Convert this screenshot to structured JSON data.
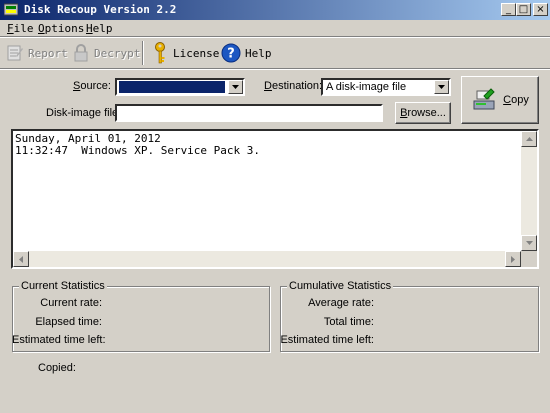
{
  "window": {
    "title": "Disk Recoup Version 2.2",
    "controls": {
      "minimize": "_",
      "maximize": "□",
      "close": "×"
    }
  },
  "menu": {
    "file": {
      "acc": "F",
      "rest": "ile"
    },
    "options": {
      "acc": "O",
      "rest": "ptions"
    },
    "help": {
      "acc": "H",
      "rest": "elp"
    }
  },
  "toolbar": {
    "report": "Report",
    "decrypt": "Decrypt",
    "license": "License",
    "help": "Help"
  },
  "form": {
    "source_label": {
      "acc": "S",
      "rest": "ource:"
    },
    "source_value": "",
    "destination_label": {
      "acc": "D",
      "rest": "estination:"
    },
    "destination_value": "A disk-image file",
    "image_label": "Disk-image file:",
    "image_value": "",
    "browse": {
      "acc": "B",
      "rest": "rowse..."
    },
    "copy": {
      "acc": "C",
      "rest": "opy"
    }
  },
  "log": {
    "lines": "Sunday, April 01, 2012\n11:32:47  Windows XP. Service Pack 3."
  },
  "current_stats": {
    "title": "Current Statistics",
    "rate": "Current rate:",
    "elapsed": "Elapsed time:",
    "est": "Estimated time left:"
  },
  "cumulative_stats": {
    "title": "Cumulative Statistics",
    "avg": "Average rate:",
    "total": "Total time:",
    "est": "Estimated time left:"
  },
  "status": {
    "copied": "Copied:"
  }
}
